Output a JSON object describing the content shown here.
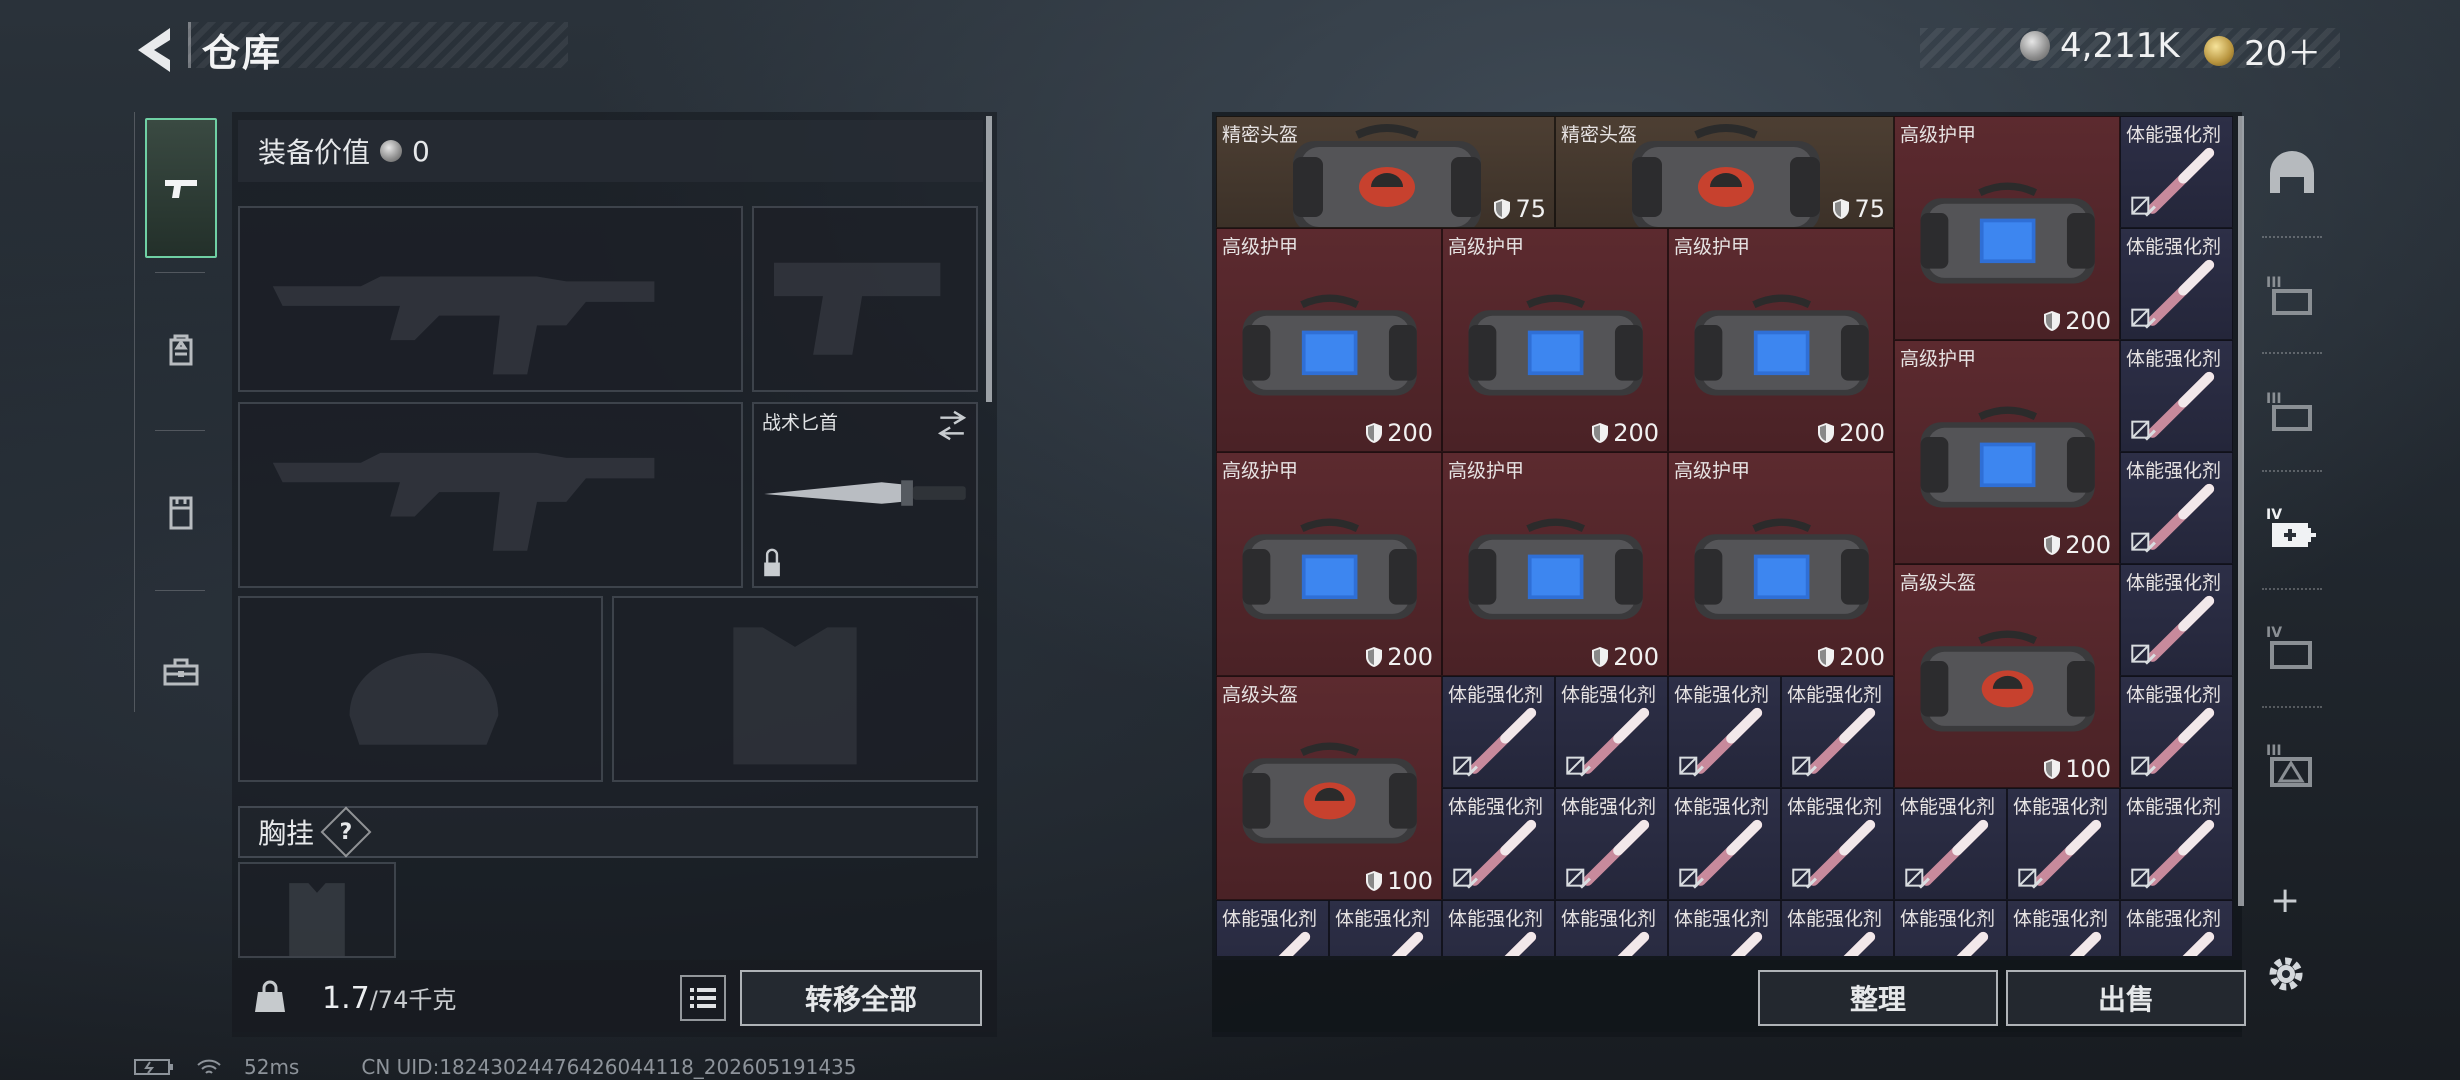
{
  "header": {
    "title": "仓库",
    "currencies": [
      {
        "icon": "silver-coin-icon",
        "value": "4,211K"
      },
      {
        "icon": "gold-coin-icon",
        "value": "20＋"
      }
    ]
  },
  "left_rail": {
    "tabs": [
      {
        "icon": "pistol-icon",
        "active": true
      },
      {
        "icon": "backpack-icon",
        "active": false
      },
      {
        "icon": "vest-icon",
        "active": false
      },
      {
        "icon": "toolbox-icon",
        "active": false
      }
    ]
  },
  "loadout": {
    "equipment_value_label": "装备价值",
    "equipment_value": "0",
    "melee_slot_label": "战术匕首",
    "chest_rig_label": "胸挂",
    "help_label": "?",
    "weight_current": "1.7",
    "weight_max": "/74千克",
    "transfer_all_label": "转移全部"
  },
  "storage": {
    "cells": [
      {
        "label": "精密头盔",
        "value": "75",
        "bg": "brown",
        "item": "helmet-case",
        "col": 0,
        "row": 0,
        "w": 3,
        "h": 1
      },
      {
        "label": "精密头盔",
        "value": "75",
        "bg": "brown",
        "item": "helmet-case",
        "col": 3,
        "row": 0,
        "w": 3,
        "h": 1
      },
      {
        "label": "高级护甲",
        "value": "200",
        "bg": "red",
        "item": "armor-case",
        "col": 6,
        "row": 0,
        "w": 2,
        "h": 2
      },
      {
        "label": "体能强化剂",
        "value": "",
        "bg": "navy",
        "item": "syringe",
        "col": 8,
        "row": 0,
        "w": 1,
        "h": 1
      },
      {
        "label": "高级护甲",
        "value": "200",
        "bg": "red",
        "item": "armor-case",
        "col": 0,
        "row": 1,
        "w": 2,
        "h": 2
      },
      {
        "label": "高级护甲",
        "value": "200",
        "bg": "red",
        "item": "armor-case",
        "col": 2,
        "row": 1,
        "w": 2,
        "h": 2
      },
      {
        "label": "高级护甲",
        "value": "200",
        "bg": "red",
        "item": "armor-case",
        "col": 4,
        "row": 1,
        "w": 2,
        "h": 2
      },
      {
        "label": "体能强化剂",
        "value": "",
        "bg": "navy",
        "item": "syringe",
        "col": 8,
        "row": 1,
        "w": 1,
        "h": 1
      },
      {
        "label": "高级护甲",
        "value": "200",
        "bg": "red",
        "item": "armor-case",
        "col": 6,
        "row": 2,
        "w": 2,
        "h": 2
      },
      {
        "label": "体能强化剂",
        "value": "",
        "bg": "navy",
        "item": "syringe",
        "col": 8,
        "row": 2,
        "w": 1,
        "h": 1
      },
      {
        "label": "高级护甲",
        "value": "200",
        "bg": "red",
        "item": "armor-case",
        "col": 0,
        "row": 3,
        "w": 2,
        "h": 2
      },
      {
        "label": "高级护甲",
        "value": "200",
        "bg": "red",
        "item": "armor-case",
        "col": 2,
        "row": 3,
        "w": 2,
        "h": 2
      },
      {
        "label": "高级护甲",
        "value": "200",
        "bg": "red",
        "item": "armor-case",
        "col": 4,
        "row": 3,
        "w": 2,
        "h": 2
      },
      {
        "label": "体能强化剂",
        "value": "",
        "bg": "navy",
        "item": "syringe",
        "col": 8,
        "row": 3,
        "w": 1,
        "h": 1
      },
      {
        "label": "高级头盔",
        "value": "100",
        "bg": "red",
        "item": "helmet-case",
        "col": 6,
        "row": 4,
        "w": 2,
        "h": 2
      },
      {
        "label": "体能强化剂",
        "value": "",
        "bg": "navy",
        "item": "syringe",
        "col": 8,
        "row": 4,
        "w": 1,
        "h": 1
      },
      {
        "label": "高级头盔",
        "value": "100",
        "bg": "red",
        "item": "helmet-case",
        "col": 0,
        "row": 5,
        "w": 2,
        "h": 2
      },
      {
        "label": "体能强化剂",
        "value": "",
        "bg": "navy",
        "item": "syringe",
        "col": 2,
        "row": 5,
        "w": 1,
        "h": 1
      },
      {
        "label": "体能强化剂",
        "value": "",
        "bg": "navy",
        "item": "syringe",
        "col": 3,
        "row": 5,
        "w": 1,
        "h": 1
      },
      {
        "label": "体能强化剂",
        "value": "",
        "bg": "navy",
        "item": "syringe",
        "col": 4,
        "row": 5,
        "w": 1,
        "h": 1
      },
      {
        "label": "体能强化剂",
        "value": "",
        "bg": "navy",
        "item": "syringe",
        "col": 5,
        "row": 5,
        "w": 1,
        "h": 1
      },
      {
        "label": "体能强化剂",
        "value": "",
        "bg": "navy",
        "item": "syringe",
        "col": 8,
        "row": 5,
        "w": 1,
        "h": 1
      },
      {
        "label": "体能强化剂",
        "value": "",
        "bg": "navy",
        "item": "syringe",
        "col": 2,
        "row": 6,
        "w": 1,
        "h": 1
      },
      {
        "label": "体能强化剂",
        "value": "",
        "bg": "navy",
        "item": "syringe",
        "col": 3,
        "row": 6,
        "w": 1,
        "h": 1
      },
      {
        "label": "体能强化剂",
        "value": "",
        "bg": "navy",
        "item": "syringe",
        "col": 4,
        "row": 6,
        "w": 1,
        "h": 1
      },
      {
        "label": "体能强化剂",
        "value": "",
        "bg": "navy",
        "item": "syringe",
        "col": 5,
        "row": 6,
        "w": 1,
        "h": 1
      },
      {
        "label": "体能强化剂",
        "value": "",
        "bg": "navy",
        "item": "syringe",
        "col": 6,
        "row": 6,
        "w": 1,
        "h": 1
      },
      {
        "label": "体能强化剂",
        "value": "",
        "bg": "navy",
        "item": "syringe",
        "col": 7,
        "row": 6,
        "w": 1,
        "h": 1
      },
      {
        "label": "体能强化剂",
        "value": "",
        "bg": "navy",
        "item": "syringe",
        "col": 8,
        "row": 6,
        "w": 1,
        "h": 1
      },
      {
        "label": "体能强化剂",
        "value": "",
        "bg": "navy",
        "item": "syringe",
        "col": 0,
        "row": 7,
        "w": 1,
        "h": 1
      },
      {
        "label": "体能强化剂",
        "value": "",
        "bg": "navy",
        "item": "syringe",
        "col": 1,
        "row": 7,
        "w": 1,
        "h": 1
      },
      {
        "label": "体能强化剂",
        "value": "",
        "bg": "navy",
        "item": "syringe",
        "col": 2,
        "row": 7,
        "w": 1,
        "h": 1
      },
      {
        "label": "体能强化剂",
        "value": "",
        "bg": "navy",
        "item": "syringe",
        "col": 3,
        "row": 7,
        "w": 1,
        "h": 1
      },
      {
        "label": "体能强化剂",
        "value": "",
        "bg": "navy",
        "item": "syringe",
        "col": 4,
        "row": 7,
        "w": 1,
        "h": 1
      },
      {
        "label": "体能强化剂",
        "value": "",
        "bg": "navy",
        "item": "syringe",
        "col": 5,
        "row": 7,
        "w": 1,
        "h": 1
      },
      {
        "label": "体能强化剂",
        "value": "",
        "bg": "navy",
        "item": "syringe",
        "col": 6,
        "row": 7,
        "w": 1,
        "h": 1
      },
      {
        "label": "体能强化剂",
        "value": "",
        "bg": "navy",
        "item": "syringe",
        "col": 7,
        "row": 7,
        "w": 1,
        "h": 1
      },
      {
        "label": "体能强化剂",
        "value": "",
        "bg": "navy",
        "item": "syringe",
        "col": 8,
        "row": 7,
        "w": 1,
        "h": 1
      }
    ],
    "sort_label": "整理",
    "sell_label": "出售"
  },
  "right_rail": {
    "tabs": [
      {
        "icon": "storage-dome-icon"
      },
      {
        "icon": "storage-tier3-a-icon"
      },
      {
        "icon": "storage-tier3-b-icon"
      },
      {
        "icon": "storage-tier4-medical-icon"
      },
      {
        "icon": "storage-tier4-folder-icon"
      },
      {
        "icon": "storage-tier3-warning-icon"
      }
    ],
    "add_label": "+"
  },
  "status_bar": {
    "ping": "52ms",
    "uid": "CN UID:18243024476426044118_202605191435"
  },
  "colors": {
    "accent_green": "#6fd0a4",
    "cell_brown": "#4d3f33",
    "cell_red": "#5c2a2f",
    "cell_navy": "#2d2f47"
  }
}
